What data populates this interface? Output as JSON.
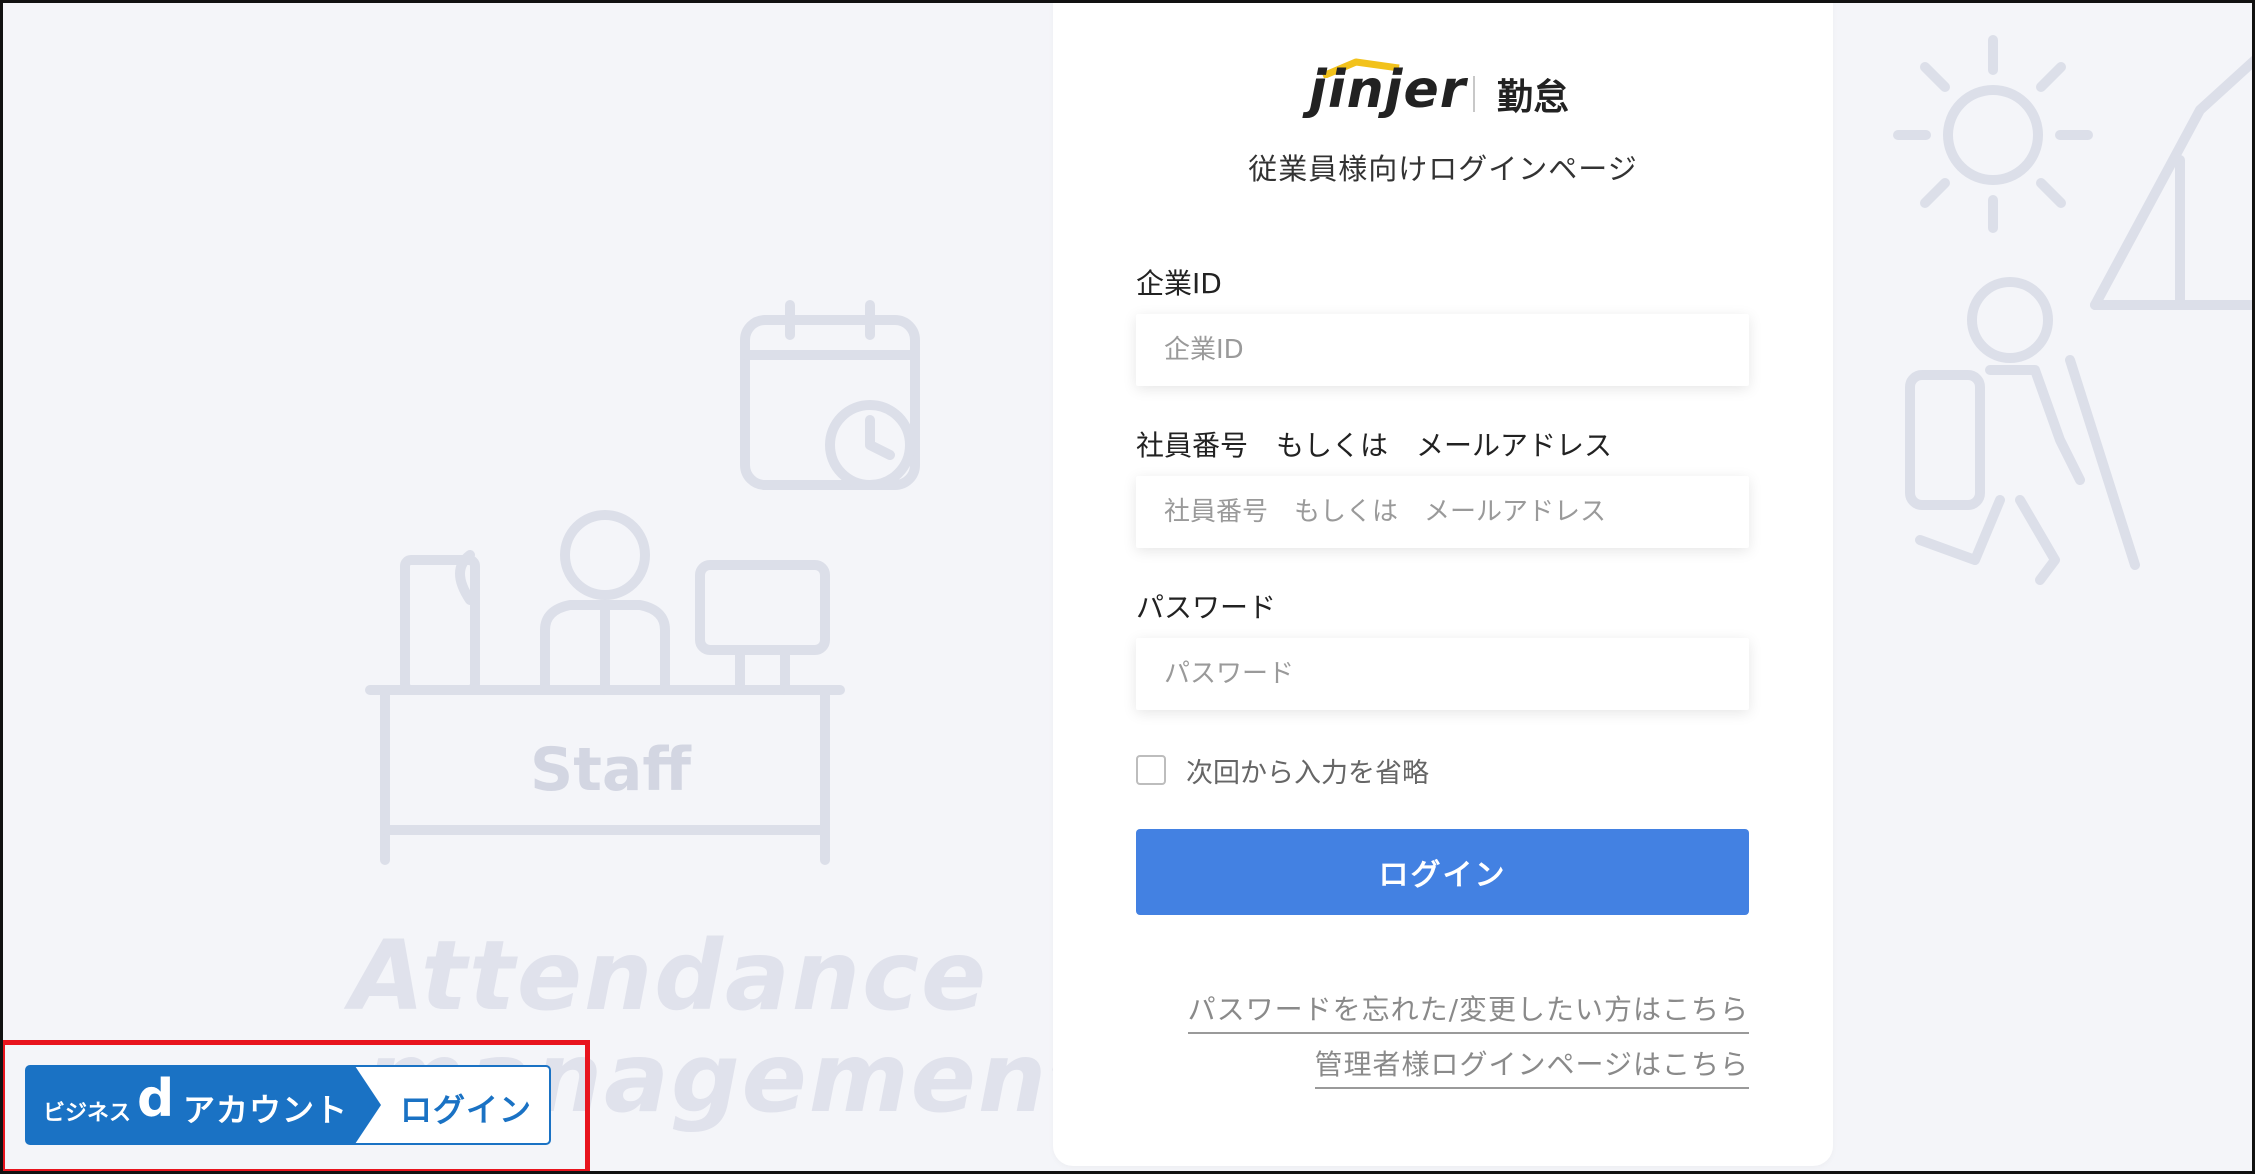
{
  "brand": {
    "logo_text": "jinjer",
    "product": "勤怠",
    "subtitle": "従業員様向けログインページ"
  },
  "background": {
    "staff_label": "Staff",
    "watermark_line1": "Attendance",
    "watermark_line2": "management"
  },
  "form": {
    "company_id": {
      "label": "企業ID",
      "placeholder": "企業ID",
      "value": ""
    },
    "employee": {
      "label": "社員番号　もしくは　メールアドレス",
      "placeholder": "社員番号　もしくは　メールアドレス",
      "value": ""
    },
    "password": {
      "label": "パスワード",
      "placeholder": "パスワード",
      "value": ""
    },
    "remember_label": "次回から入力を省略",
    "remember_checked": false,
    "login_button": "ログイン"
  },
  "links": {
    "forgot_password": "パスワードを忘れた/変更したい方はこちら",
    "admin_login": "管理者様ログインページはこちら"
  },
  "d_account": {
    "prefix": "ビジネス",
    "d_letter": "d",
    "account": "アカウント",
    "login": "ログイン"
  },
  "colors": {
    "primary": "#4381e2",
    "d_account_blue": "#1a72c4",
    "highlight": "#e8141e",
    "background": "#f4f5f9"
  }
}
